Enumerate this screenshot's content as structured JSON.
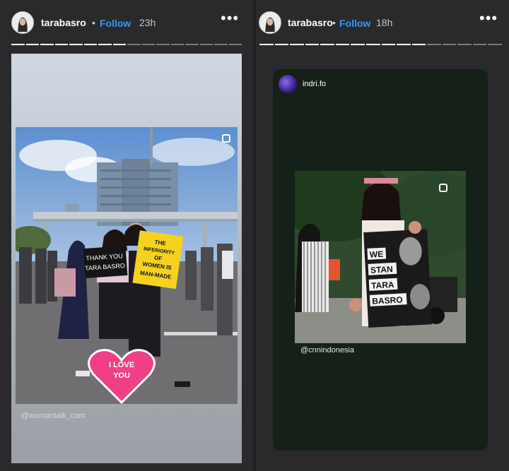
{
  "left_story": {
    "username": "tarabasro",
    "separator": "•",
    "follow_label": "Follow",
    "time": "23h",
    "more_label": "•••",
    "progress": {
      "segments": 16,
      "completed": 8
    },
    "photo_signs": {
      "sign1": "THANK YOU TARA BASRO",
      "sign2": "THE INFERIORITY OF WOMEN IS MAN-MADE",
      "heart": "I LOVE YOU"
    },
    "credit": "@womantalk_com"
  },
  "right_story": {
    "username": "tarabasro",
    "separator": "•",
    "follow_label": "Follow",
    "time": "18h",
    "more_label": "•••",
    "progress": {
      "segments": 16,
      "completed": 11
    },
    "reshared_user": "indri.fo",
    "photo_sign": "WE STAN TARA BASRO",
    "credit": "@cnnindonesia"
  },
  "colors": {
    "follow": "#3897f0",
    "background": "#2a2a2c",
    "right_card": "#142018"
  }
}
